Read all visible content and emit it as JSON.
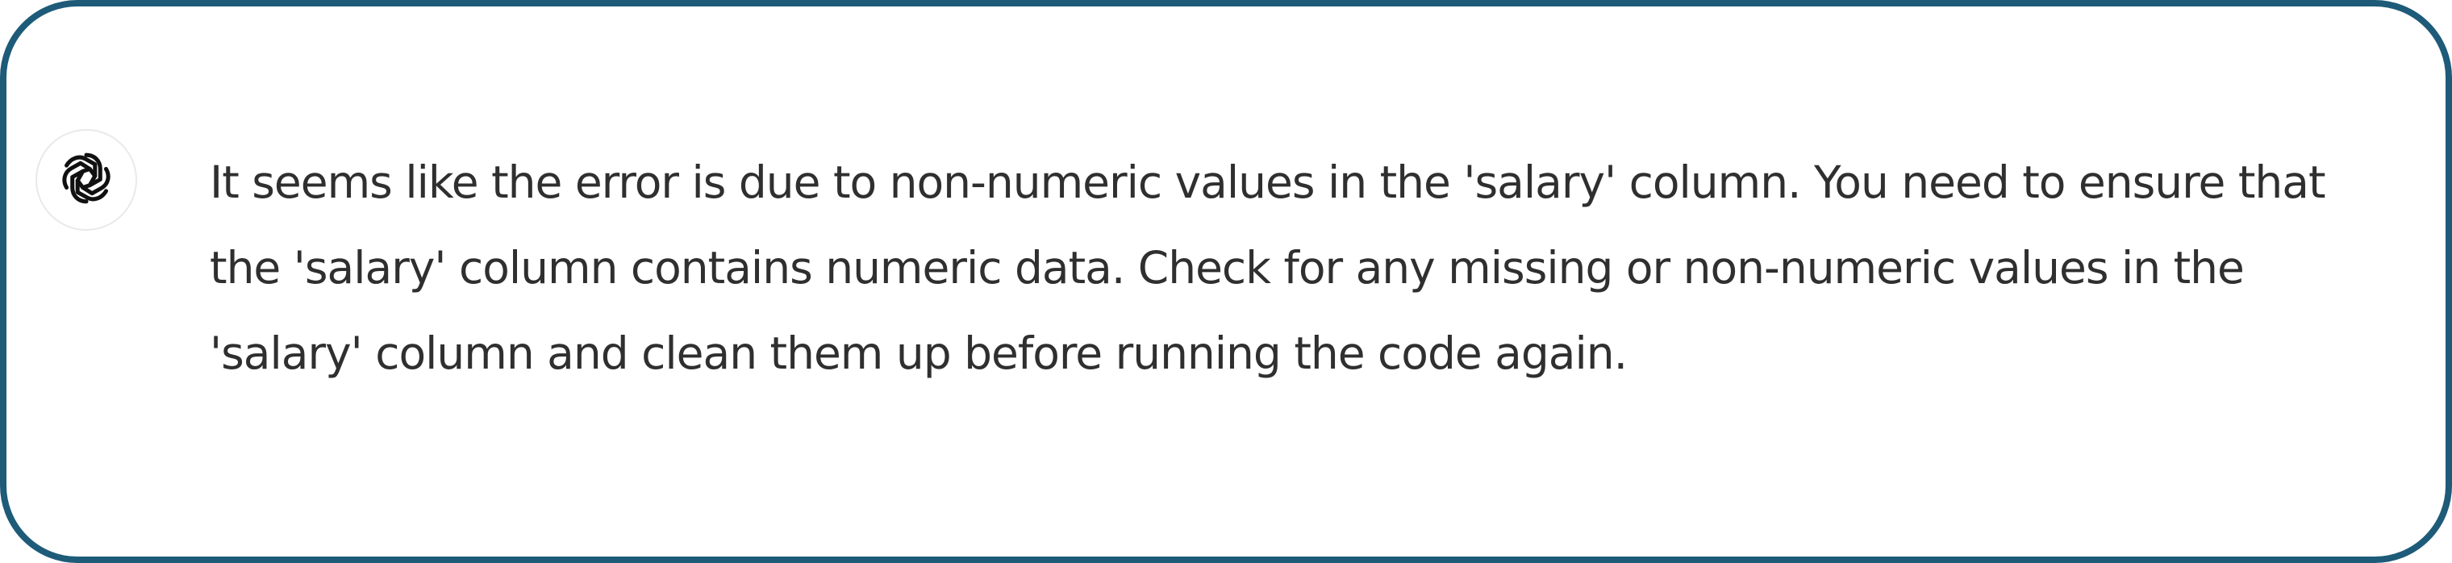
{
  "assistant": {
    "avatar_icon": "openai-logo-icon",
    "message_lines": [
      "It seems like the error is due to non-numeric values in the 'salary' column. You need to ensure that",
      "the 'salary' column contains numeric data. Check for any missing or non-numeric values in the",
      "'salary' column and clean them up before running the code again."
    ]
  },
  "colors": {
    "frame_border": "#1d5b79",
    "text": "#2f2f2f",
    "avatar_border": "#e9e9e9"
  }
}
